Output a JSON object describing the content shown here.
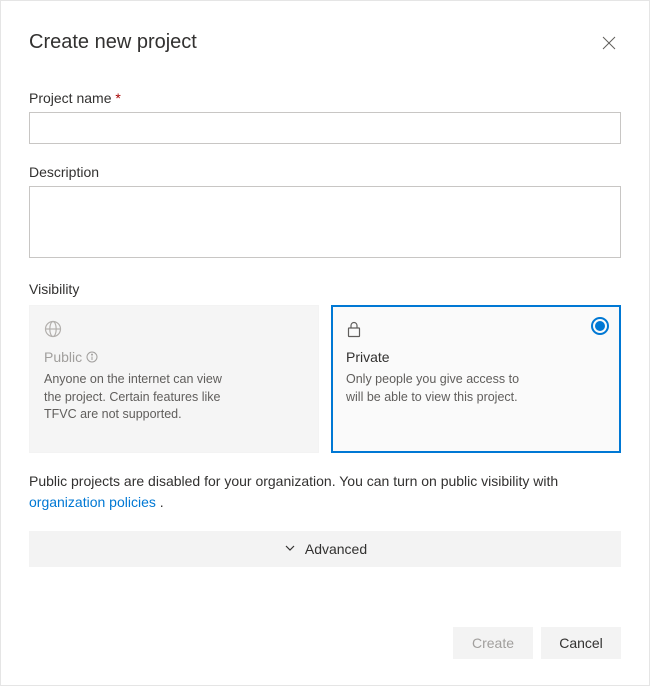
{
  "header": {
    "title": "Create new project"
  },
  "fields": {
    "projectName": {
      "label": "Project name",
      "required": "*",
      "value": ""
    },
    "description": {
      "label": "Description",
      "value": ""
    }
  },
  "visibility": {
    "label": "Visibility",
    "public": {
      "title": "Public",
      "desc": "Anyone on the internet can view the project. Certain features like TFVC are not supported."
    },
    "private": {
      "title": "Private",
      "desc": "Only people you give access to will be able to view this project."
    },
    "noteBefore": "Public projects are disabled for your organization. You can turn on public visibility with ",
    "noteLink": "organization policies"
  },
  "advanced": {
    "label": "Advanced"
  },
  "buttons": {
    "create": "Create",
    "cancel": "Cancel"
  }
}
